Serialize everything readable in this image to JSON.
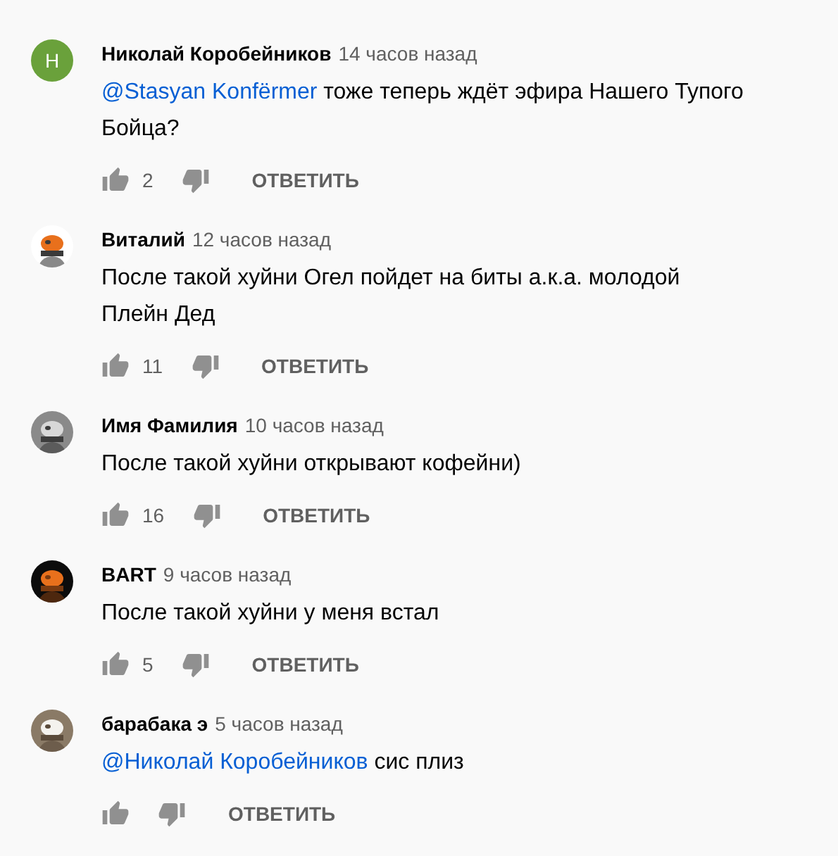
{
  "comments": [
    {
      "author": "Николай Коробейников",
      "time": "14 часов назад",
      "avatar": {
        "kind": "letter",
        "letter": "Н",
        "color": "#6aa13b"
      },
      "body": [
        [
          {
            "kind": "mention",
            "text": "@Stasyan Konfërmer"
          },
          {
            "kind": "text",
            "text": "тоже теперь ждёт эфира Нашего Тупого"
          }
        ],
        [
          {
            "kind": "text",
            "text": "Бойца?"
          }
        ]
      ],
      "likes": "2",
      "reply": "ОТВЕТИТЬ"
    },
    {
      "author": "Виталий",
      "time": "12 часов назад",
      "avatar": {
        "kind": "picture"
      },
      "body": [
        [
          {
            "kind": "text",
            "text": "После такой хуйни Огел пойдет на биты а.к.а. молодой"
          }
        ],
        [
          {
            "kind": "text",
            "text": "Плейн Дед"
          }
        ]
      ],
      "likes": "11",
      "reply": "ОТВЕТИТЬ"
    },
    {
      "author": "Имя Фамилия",
      "time": "10 часов назад",
      "avatar": {
        "kind": "picture"
      },
      "body": [
        [
          {
            "kind": "text",
            "text": "После такой хуйни открывают кофейни)"
          }
        ]
      ],
      "likes": "16",
      "reply": "ОТВЕТИТЬ"
    },
    {
      "author": "BART",
      "time": "9 часов назад",
      "avatar": {
        "kind": "picture"
      },
      "body": [
        [
          {
            "kind": "text",
            "text": "После такой хуйни у меня встал"
          }
        ]
      ],
      "likes": "5",
      "reply": "ОТВЕТИТЬ"
    },
    {
      "author": "барабака э",
      "time": "5 часов назад",
      "avatar": {
        "kind": "picture"
      },
      "body": [
        [
          {
            "kind": "mention",
            "text": "@Николай Коробейников"
          },
          {
            "kind": "text",
            "text": "сис плиз"
          }
        ]
      ],
      "reply": "ОТВЕТИТЬ"
    }
  ]
}
